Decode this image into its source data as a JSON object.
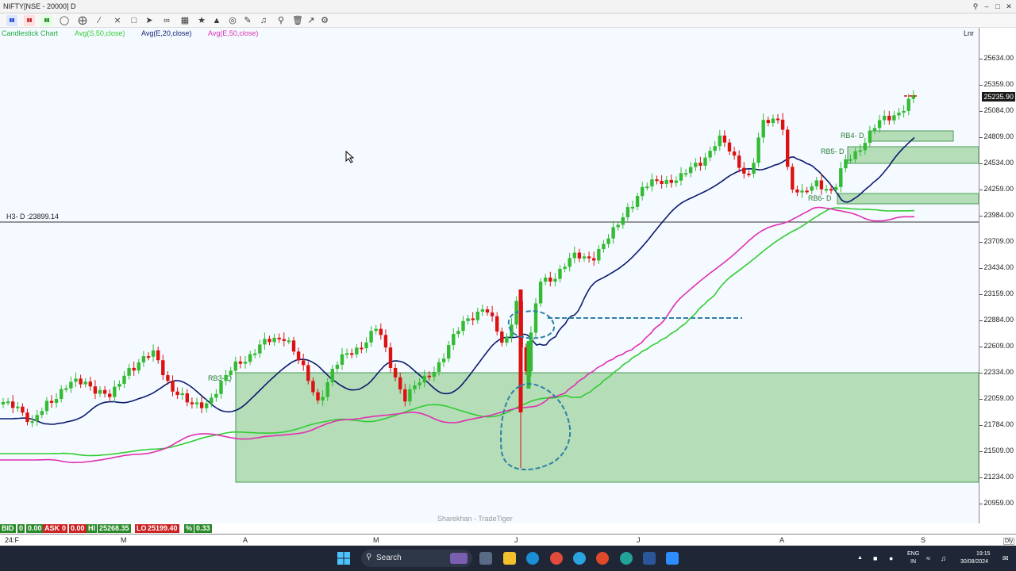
{
  "window": {
    "title": "NIFTY[NSE - 20000] D"
  },
  "chart": {
    "watermark": "Sharekhan - TradeTiger",
    "scale_mode": "Lnr",
    "last_price": "25235.90",
    "hline_label": "H3- D :23899.14",
    "zone_labels": [
      "RB3- Q",
      "RB4- D",
      "RB5- D",
      "RB6- D"
    ],
    "indicators": [
      {
        "label": "Candlestick Chart",
        "color": "#22aa44"
      },
      {
        "label": "Avg(S,50,close)",
        "color": "#33cc33"
      },
      {
        "label": "Avg(E,20,close)",
        "color": "#0c1a6e"
      },
      {
        "label": "Avg(E,50,close)",
        "color": "#e030b0"
      }
    ]
  },
  "price_axis": [
    "25634.00",
    "25359.00",
    "25084.00",
    "24809.00",
    "24534.00",
    "24259.00",
    "23984.00",
    "23709.00",
    "23434.00",
    "23159.00",
    "22884.00",
    "22609.00",
    "22334.00",
    "22059.00",
    "21784.00",
    "21509.00",
    "21234.00",
    "20959.00"
  ],
  "time_axis": [
    "24:F",
    "M",
    "A",
    "M",
    "J",
    "J",
    "A",
    "S"
  ],
  "status": {
    "bid_label": "BID",
    "bid": "0",
    "bid2": "0.00",
    "ask_label": "ASK",
    "ask": "0",
    "ask2": "0.00",
    "hi_label": "HI",
    "hi": "25268.35",
    "lo_label": "LO",
    "lo": "25199.40",
    "pct_label": "%",
    "pct": "0.33"
  },
  "corner_label": "Dly",
  "taskbar": {
    "search_placeholder": "Search",
    "lang": "ENG",
    "region": "IN",
    "time": "19:15",
    "date": "30/08/2024"
  },
  "colors": {
    "up_candle": "#33bb33",
    "down_candle": "#dd1111",
    "zone_fill": "#b4ddb8",
    "ema20": "#0c1a6e",
    "sma50": "#33cc33",
    "ema50": "#e030b0",
    "annotation": "#2f7fa6"
  }
}
